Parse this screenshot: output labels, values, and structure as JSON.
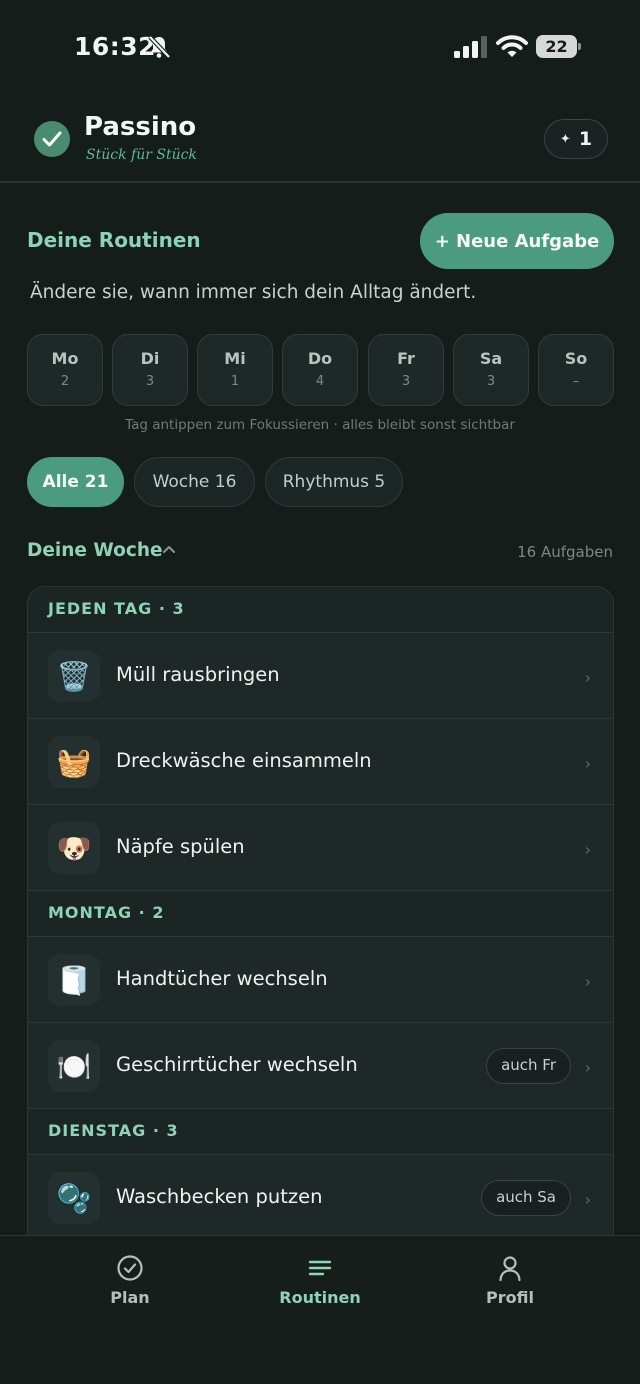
{
  "status_bar": {
    "time": "16:32",
    "battery": "22"
  },
  "header": {
    "app_name": "Passino",
    "tagline": "Stück für Stück",
    "points": "1"
  },
  "routines": {
    "title": "Deine Routinen",
    "add_button": "+ Neue Aufgabe",
    "subtitle": "Ändere sie, wann immer sich dein Alltag ändert."
  },
  "days": [
    {
      "name": "Mo",
      "count": "2"
    },
    {
      "name": "Di",
      "count": "3"
    },
    {
      "name": "Mi",
      "count": "1"
    },
    {
      "name": "Do",
      "count": "4"
    },
    {
      "name": "Fr",
      "count": "3"
    },
    {
      "name": "Sa",
      "count": "3"
    },
    {
      "name": "So",
      "count": "–"
    }
  ],
  "day_hint": "Tag antippen zum Fokussieren · alles bleibt sonst sichtbar",
  "filters": [
    {
      "label": "Alle 21",
      "active": true
    },
    {
      "label": "Woche 16",
      "active": false
    },
    {
      "label": "Rhythmus 5",
      "active": false
    }
  ],
  "week": {
    "title": "Deine Woche",
    "count": "16 Aufgaben"
  },
  "groups": [
    {
      "title": "JEDEN TAG · 3",
      "tasks": [
        {
          "icon": "wastebasket-icon",
          "emoji": "🗑️",
          "label": "Müll rausbringen"
        },
        {
          "icon": "laundry-basket-icon",
          "emoji": "🧺",
          "label": "Dreckwäsche einsammeln"
        },
        {
          "icon": "dog-icon",
          "emoji": "🐶",
          "label": "Näpfe spülen"
        }
      ]
    },
    {
      "title": "MONTAG · 2",
      "tasks": [
        {
          "icon": "towel-roll-icon",
          "emoji": "🧻",
          "label": "Handtücher wechseln"
        },
        {
          "icon": "plate-cutlery-icon",
          "emoji": "🍽️",
          "label": "Geschirrtücher wechseln",
          "tag": "auch Fr"
        }
      ]
    },
    {
      "title": "DIENSTAG · 3",
      "tasks": [
        {
          "icon": "bubbles-icon",
          "emoji": "🫧",
          "label": "Waschbecken putzen",
          "tag": "auch Sa"
        }
      ]
    }
  ],
  "tabs": [
    {
      "icon": "check-circle-icon",
      "label": "Plan"
    },
    {
      "icon": "list-icon",
      "label": "Routinen"
    },
    {
      "icon": "person-icon",
      "label": "Profil"
    }
  ],
  "colors": {
    "background": "#151d1b",
    "accent": "#4b9b80",
    "accent_text": "#8fd3b6"
  }
}
